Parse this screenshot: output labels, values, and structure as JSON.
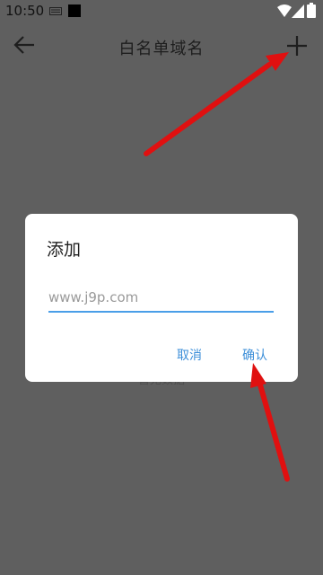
{
  "status_bar": {
    "time": "10:50",
    "icons": [
      "keyboard-icon",
      "stop-icon",
      "wifi-icon",
      "signal-icon",
      "battery-icon"
    ]
  },
  "app_bar": {
    "title": "白名单域名",
    "back_icon": "back-arrow-icon",
    "add_icon": "plus-icon"
  },
  "background": {
    "hint": "暂无数据"
  },
  "dialog": {
    "title": "添加",
    "input_value": "",
    "input_placeholder": "www.j9p.com",
    "cancel_label": "取消",
    "confirm_label": "确认"
  },
  "colors": {
    "overlay_bg": "#5f5f5f",
    "accent": "#3d8fd9",
    "annotation_arrow": "#e01010"
  }
}
